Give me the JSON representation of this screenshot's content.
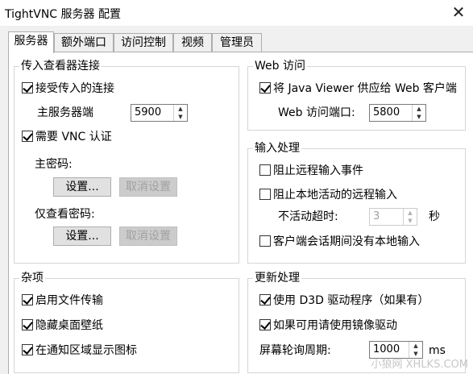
{
  "window": {
    "title": "TightVNC 服务器 配置",
    "close": "✕"
  },
  "tabs": [
    "服务器",
    "额外端口",
    "访问控制",
    "视频",
    "管理员"
  ],
  "incoming": {
    "label": "传入查看器连接",
    "accept": "接受传入的连接",
    "main_port_label": "主服务器端",
    "main_port_value": "5900",
    "require_auth": "需要 VNC 认证",
    "main_password_label": "主密码:",
    "set_button": "设置...",
    "unset_button": "取消设置",
    "viewonly_password_label": "仅查看密码:",
    "set_button2": "设置...",
    "unset_button2": "取消设置"
  },
  "web": {
    "label": "Web 访问",
    "serve_java": "将 Java Viewer 供应给 Web 客户端",
    "port_label": "Web 访问端口:",
    "port_value": "5800"
  },
  "input": {
    "label": "输入处理",
    "block_remote": "阻止远程输入事件",
    "block_on_local": "阻止本地活动的远程输入",
    "timeout_label": "不活动超时:",
    "timeout_value": "3",
    "timeout_unit": "秒",
    "no_local_input": "客户端会话期间没有本地输入"
  },
  "misc": {
    "label": "杂项",
    "file_transfer": "启用文件传输",
    "hide_wallpaper": "隐藏桌面壁纸",
    "tray_icon": "在通知区域显示图标"
  },
  "update": {
    "label": "更新处理",
    "use_d3d": "使用 D3D 驱动程序（如果有）",
    "mirror": "如果可用请使用镜像驱动",
    "poll_label": "屏幕轮询周期:",
    "poll_value": "1000",
    "poll_unit": "ms"
  },
  "watermark": "小狼网 XHLKS.COM"
}
